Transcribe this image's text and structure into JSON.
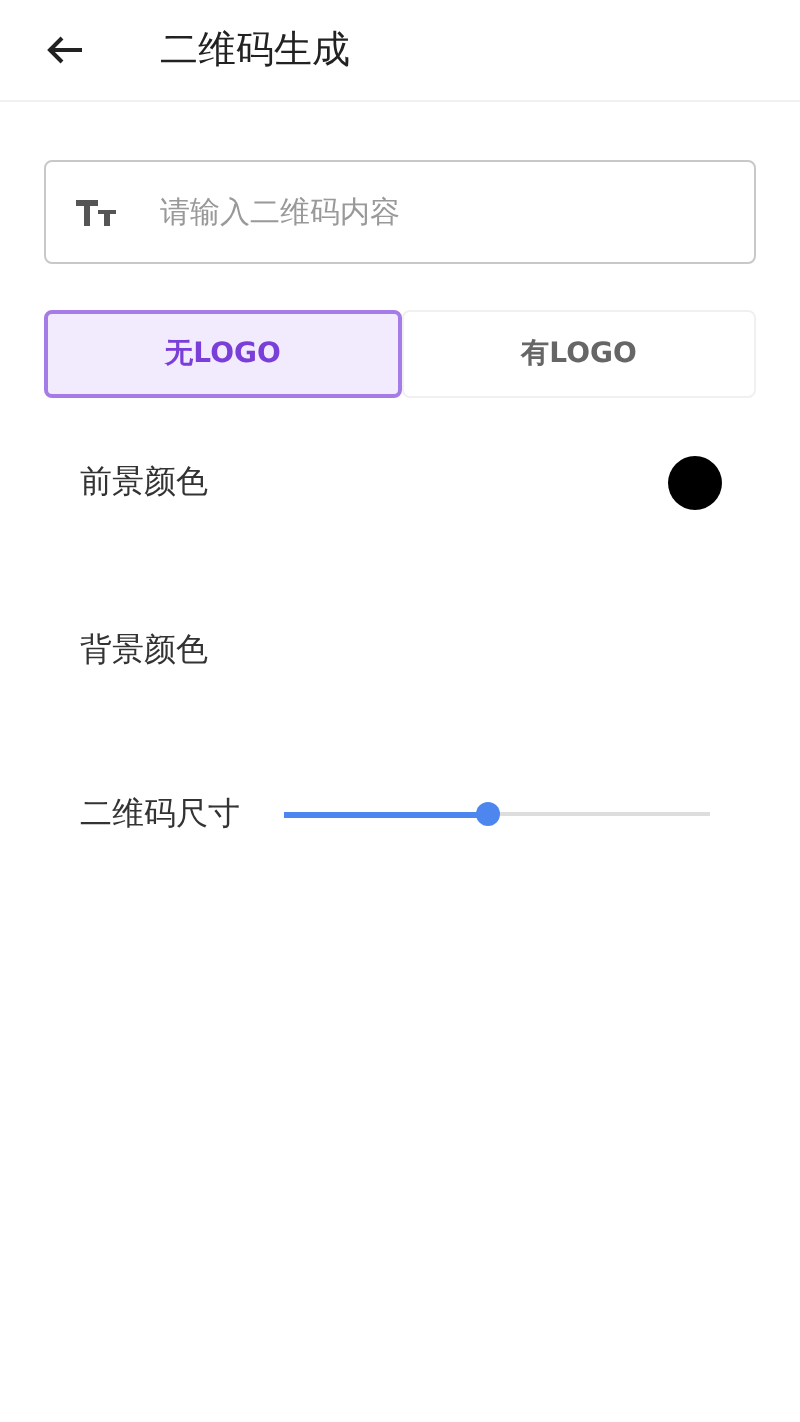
{
  "header": {
    "title": "二维码生成"
  },
  "input": {
    "placeholder": "请输入二维码内容"
  },
  "logo_tabs": [
    {
      "label": "无LOGO",
      "selected": true
    },
    {
      "label": "有LOGO",
      "selected": false
    }
  ],
  "settings": [
    {
      "kind": "color",
      "label": "前景颜色",
      "color": "#000000"
    },
    {
      "kind": "color",
      "label": "背景颜色"
    },
    {
      "kind": "slider",
      "label": "二维码尺寸",
      "level": 0.48
    }
  ]
}
